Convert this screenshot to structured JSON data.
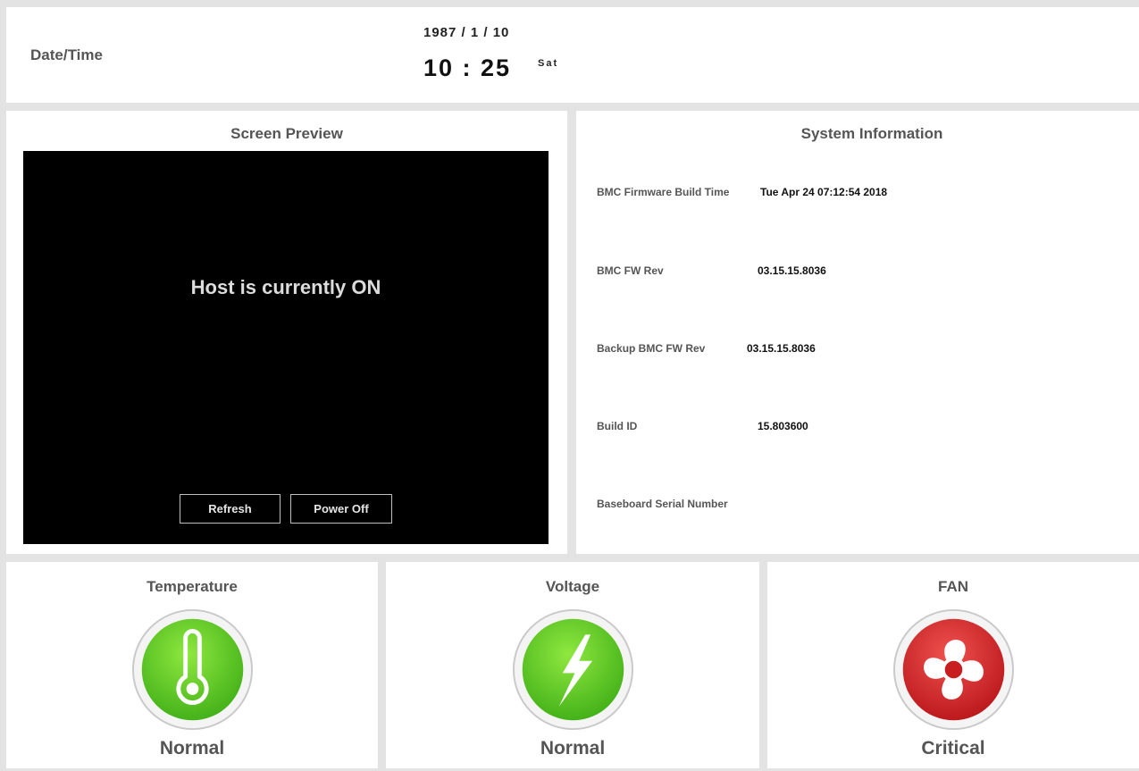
{
  "datetime": {
    "label": "Date/Time",
    "date": "1987 / 1 / 10",
    "time": "10 : 25",
    "day": "Sat"
  },
  "preview": {
    "title": "Screen Preview",
    "message": "Host is currently ON",
    "refresh_label": "Refresh",
    "power_off_label": "Power Off"
  },
  "system_info": {
    "title": "System Information",
    "rows": [
      {
        "label": "BMC Firmware Build Time",
        "value": "Tue Apr 24 07:12:54 2018"
      },
      {
        "label": "BMC FW Rev",
        "value": "03.15.15.8036"
      },
      {
        "label": "Backup BMC FW Rev",
        "value": "03.15.15.8036"
      },
      {
        "label": "Build ID",
        "value": "15.803600"
      },
      {
        "label": "Baseboard Serial Number",
        "value": ""
      }
    ]
  },
  "status": {
    "temperature": {
      "title": "Temperature",
      "state": "Normal",
      "icon": "thermometer-icon",
      "color": "#52c41a"
    },
    "voltage": {
      "title": "Voltage",
      "state": "Normal",
      "icon": "lightning-icon",
      "color": "#52c41a"
    },
    "fan": {
      "title": "FAN",
      "state": "Critical",
      "icon": "fan-icon",
      "color": "#d62222"
    }
  }
}
